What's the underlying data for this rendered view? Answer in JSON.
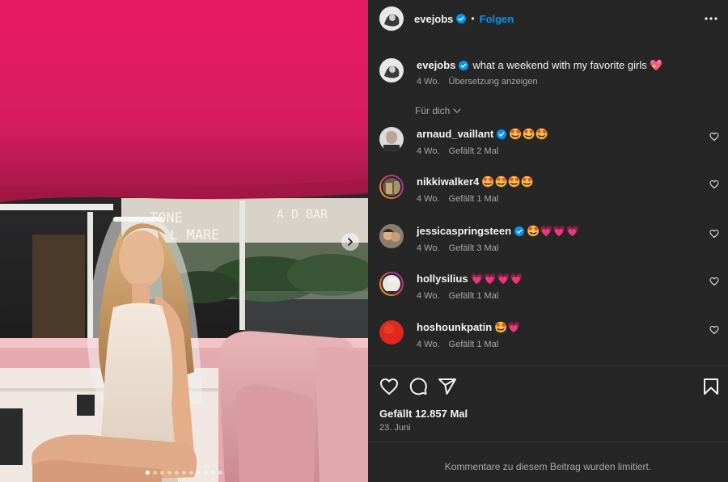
{
  "post": {
    "username": "evejobs",
    "follow_label": "Folgen",
    "separator": "•",
    "caption_text": "what a weekend with my favorite girls 💖",
    "caption_time": "4 Wo.",
    "translate_label": "Übersetzung anzeigen",
    "image_alt": "Woman in white dress with bridal veil sitting in pink vintage car",
    "carousel_count": 11,
    "carousel_active": 1,
    "sign_text_1": "TONE",
    "sign_text_2": "L MARE",
    "sign_text_3": "A D BAR"
  },
  "filter": {
    "label": "Für dich"
  },
  "comments": [
    {
      "username": "arnaud_vaillant",
      "verified": true,
      "text": "🤩🤩🤩",
      "time": "4 Wo.",
      "likes": "Gefällt 2 Mal"
    },
    {
      "username": "nikkiwalker4",
      "verified": false,
      "text": "🤩🤩🤩🤩",
      "time": "4 Wo.",
      "likes": "Gefällt 1 Mal"
    },
    {
      "username": "jessicaspringsteen",
      "verified": true,
      "text": "🤩💗💗💗",
      "time": "4 Wo.",
      "likes": "Gefällt 3 Mal"
    },
    {
      "username": "hollysilius",
      "verified": false,
      "text": "💗💗💗💗",
      "time": "4 Wo.",
      "likes": "Gefällt 1 Mal"
    },
    {
      "username": "hoshounkpatin",
      "verified": false,
      "text": "🤩💗",
      "time": "4 Wo.",
      "likes": "Gefällt 1 Mal"
    }
  ],
  "footer": {
    "likes_label": "Gefällt 12.857 Mal",
    "date_label": "23. Juni",
    "limited_label": "Kommentare zu diesem Beitrag wurden limitiert."
  },
  "colors": {
    "panel_bg": "#262626",
    "accent": "#0095f6",
    "secondary_text": "#a8a8a8",
    "verified": "#0095f6",
    "canopy": "#e0245e"
  },
  "icons": [
    "more-icon",
    "verified-icon",
    "chevron-down-icon",
    "heart-icon",
    "comment-icon",
    "share-icon",
    "bookmark-icon",
    "chevron-right-icon"
  ]
}
